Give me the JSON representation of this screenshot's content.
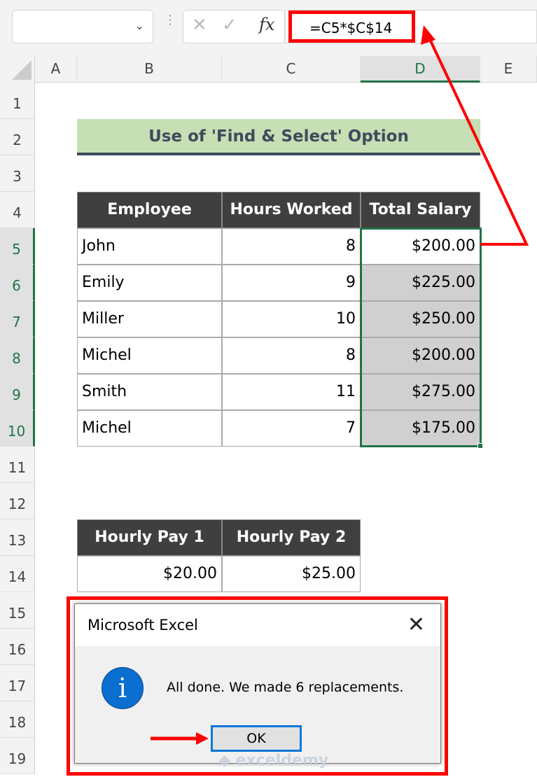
{
  "formula_bar": {
    "name_box": "",
    "formula": "=C5*$C$14",
    "cancel_icon": "x-icon",
    "enter_icon": "check-icon",
    "fx_label": "fx"
  },
  "columns": [
    "A",
    "B",
    "C",
    "D",
    "E"
  ],
  "rows": [
    "1",
    "2",
    "3",
    "4",
    "5",
    "6",
    "7",
    "8",
    "9",
    "10",
    "11",
    "12",
    "13",
    "14",
    "15",
    "16",
    "17",
    "18",
    "19"
  ],
  "title": "Use of 'Find & Select' Option",
  "table": {
    "headers": [
      "Employee",
      "Hours Worked",
      "Total Salary"
    ],
    "rows": [
      [
        "John",
        "8",
        "$200.00"
      ],
      [
        "Emily",
        "9",
        "$225.00"
      ],
      [
        "Miller",
        "10",
        "$250.00"
      ],
      [
        "Michel",
        "8",
        "$200.00"
      ],
      [
        "Smith",
        "11",
        "$275.00"
      ],
      [
        "Michel",
        "7",
        "$175.00"
      ]
    ]
  },
  "pay_table": {
    "headers": [
      "Hourly Pay 1",
      "Hourly Pay 2"
    ],
    "values": [
      "$20.00",
      "$25.00"
    ]
  },
  "dialog": {
    "title": "Microsoft Excel",
    "message": "All done. We made 6 replacements.",
    "ok": "OK",
    "icon": "info-icon"
  },
  "watermark": "exceldemy",
  "colors": {
    "highlight": "#ff0000",
    "selection": "#217346",
    "title_band": "#c6dfb4",
    "header_bg": "#3f3f3f"
  }
}
